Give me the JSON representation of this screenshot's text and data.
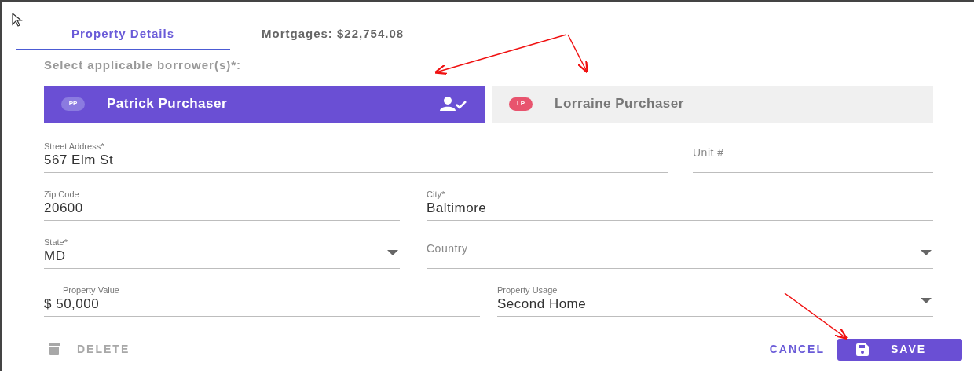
{
  "tabs": [
    {
      "label": "Property Details",
      "selected": true
    },
    {
      "label": "Mortgages: $22,754.08",
      "selected": false
    }
  ],
  "borrower_prompt": "Select applicable borrower(s)*:",
  "borrowers": [
    {
      "initials": "PP",
      "name": "Patrick Purchaser",
      "selected": true,
      "color": "#8b7be0"
    },
    {
      "initials": "LP",
      "name": "Lorraine Purchaser",
      "selected": false,
      "color": "#e8546e"
    }
  ],
  "field_rows": [
    [
      {
        "kind": "text",
        "label": "Street Address*",
        "value": "567 Elm St"
      },
      {
        "kind": "text",
        "placeholder": "Unit #"
      }
    ],
    [
      {
        "kind": "text",
        "label": "Zip Code",
        "value": "20600"
      },
      {
        "kind": "text",
        "label": "City*",
        "value": "Baltimore"
      }
    ],
    [
      {
        "kind": "select",
        "label": "State*",
        "value": "MD"
      },
      {
        "kind": "select",
        "placeholder": "Country"
      }
    ],
    [
      {
        "kind": "money",
        "label": "Property Value",
        "value": "$ 50,000"
      },
      {
        "kind": "select",
        "label": "Property Usage",
        "value": "Second Home"
      }
    ]
  ],
  "actions": {
    "delete": {
      "label": "DELETE",
      "disabled": true
    },
    "cancel": {
      "label": "CANCEL"
    },
    "save": {
      "label": "SAVE"
    }
  }
}
